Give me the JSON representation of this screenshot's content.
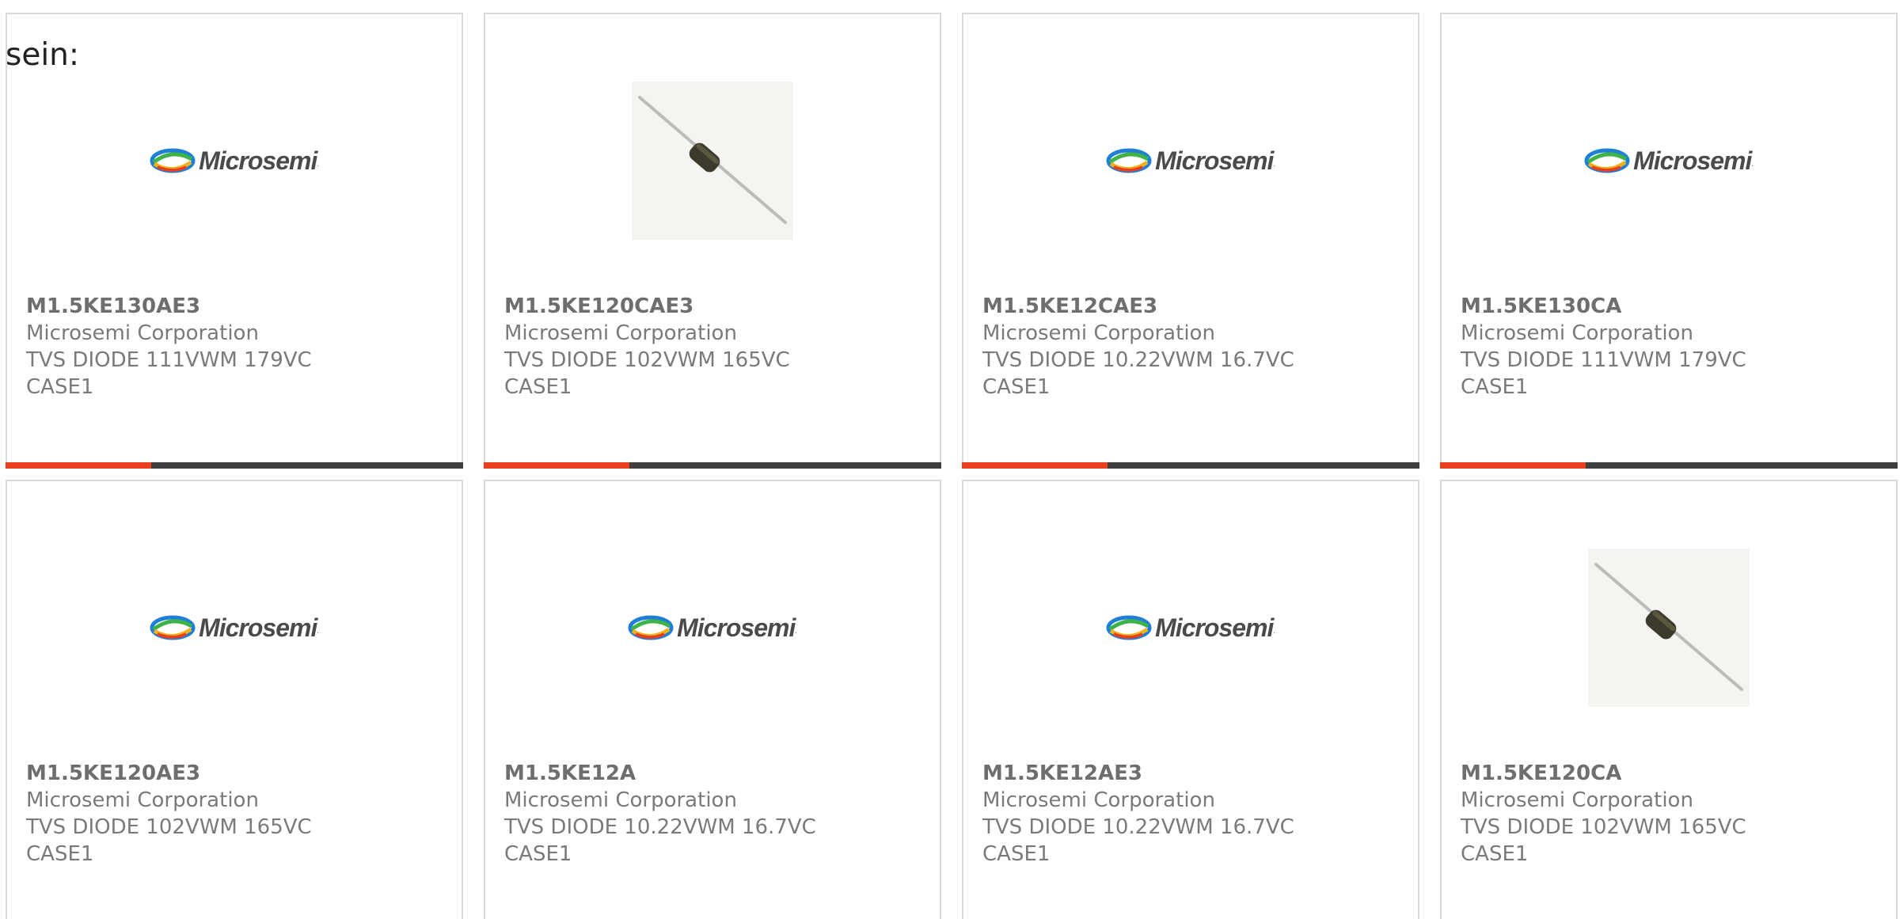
{
  "heading": "sein:",
  "colors": {
    "accent": "#e8401d",
    "bar": "#3f3f3f",
    "card_border": "#d9d9d9",
    "text": "#7a7a7a"
  },
  "brand_logo": {
    "text": "Microsemi",
    "icon": "microsemi-swirl-logo"
  },
  "products": [
    {
      "part_number": "M1.5KE130AE3",
      "manufacturer": "Microsemi Corporation",
      "description": "TVS DIODE 111VWM 179VC",
      "package": "CASE1",
      "image": "microsemi-logo"
    },
    {
      "part_number": "M1.5KE120CAE3",
      "manufacturer": "Microsemi Corporation",
      "description": "TVS DIODE 102VWM 165VC",
      "package": "CASE1",
      "image": "axial-diode-photo"
    },
    {
      "part_number": "M1.5KE12CAE3",
      "manufacturer": "Microsemi Corporation",
      "description": "TVS DIODE 10.22VWM 16.7VC",
      "package": "CASE1",
      "image": "microsemi-logo"
    },
    {
      "part_number": "M1.5KE130CA",
      "manufacturer": "Microsemi Corporation",
      "description": "TVS DIODE 111VWM 179VC",
      "package": "CASE1",
      "image": "microsemi-logo"
    },
    {
      "part_number": "M1.5KE120AE3",
      "manufacturer": "Microsemi Corporation",
      "description": "TVS DIODE 102VWM 165VC",
      "package": "CASE1",
      "image": "microsemi-logo"
    },
    {
      "part_number": "M1.5KE12A",
      "manufacturer": "Microsemi Corporation",
      "description": "TVS DIODE 10.22VWM 16.7VC",
      "package": "CASE1",
      "image": "microsemi-logo"
    },
    {
      "part_number": "M1.5KE12AE3",
      "manufacturer": "Microsemi Corporation",
      "description": "TVS DIODE 10.22VWM 16.7VC",
      "package": "CASE1",
      "image": "microsemi-logo"
    },
    {
      "part_number": "M1.5KE120CA",
      "manufacturer": "Microsemi Corporation",
      "description": "TVS DIODE 102VWM 165VC",
      "package": "CASE1",
      "image": "axial-diode-photo"
    }
  ]
}
